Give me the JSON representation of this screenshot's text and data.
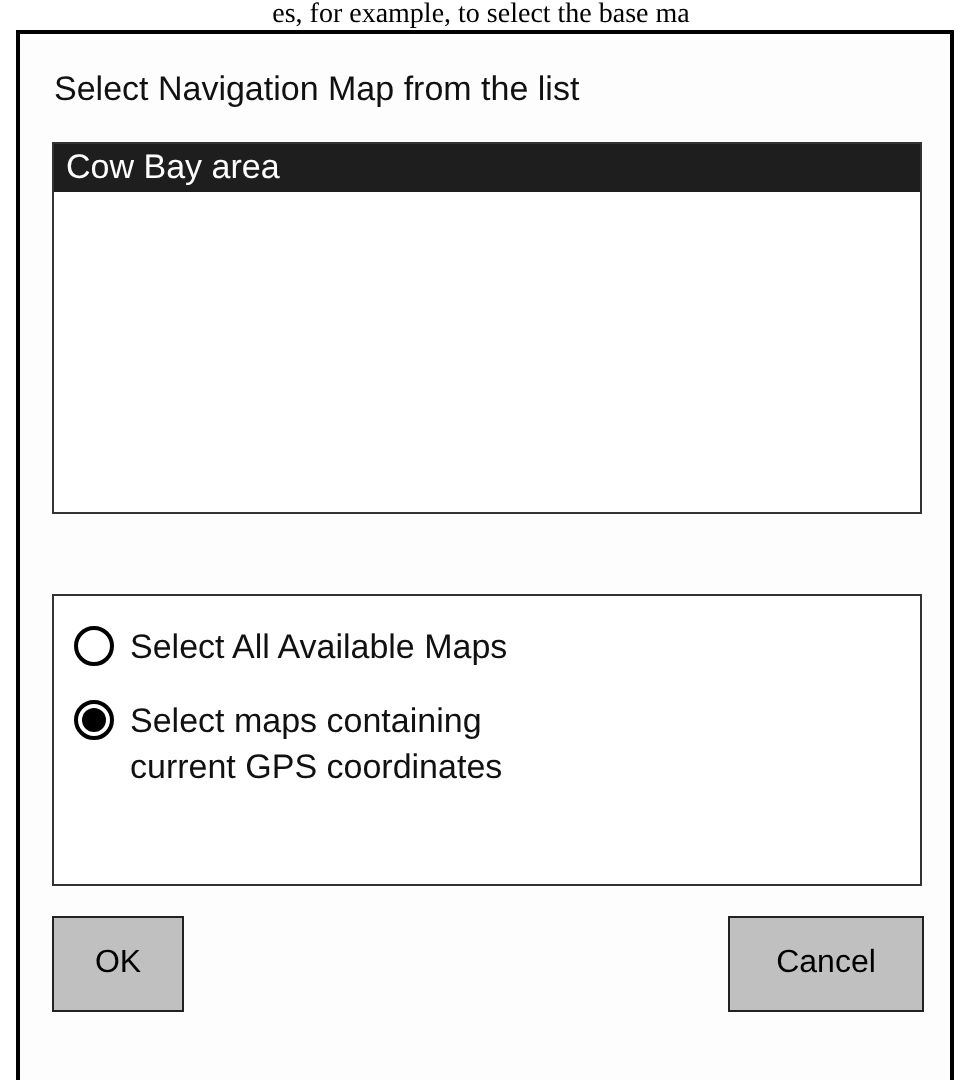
{
  "caption_fragment": "es, for example, to select the base ma",
  "dialog": {
    "title": "Select Navigation Map from the list",
    "maps": [
      {
        "label": "Cow Bay area",
        "selected": true
      }
    ],
    "options": [
      {
        "label": "Select All Available Maps",
        "selected": false
      },
      {
        "label": "Select maps containing\ncurrent GPS coordinates",
        "selected": true
      }
    ],
    "buttons": [
      "OK",
      "Cancel"
    ]
  }
}
